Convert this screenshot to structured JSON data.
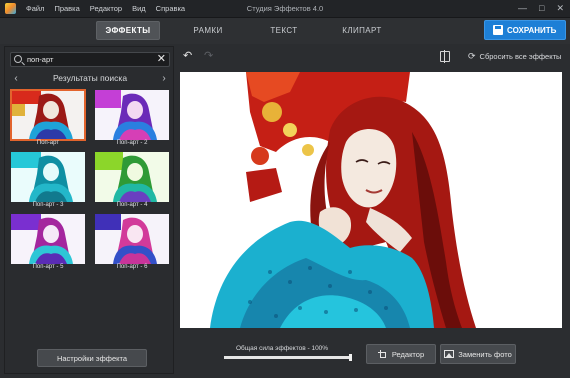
{
  "window": {
    "title": "Студия Эффектов 4.0",
    "menu": [
      "Файл",
      "Правка",
      "Редактор",
      "Вид",
      "Справка"
    ]
  },
  "tabs": [
    {
      "label": "ЭФФЕКТЫ",
      "active": true
    },
    {
      "label": "РАМКИ",
      "active": false
    },
    {
      "label": "ТЕКСТ",
      "active": false
    },
    {
      "label": "КЛИПАРТ",
      "active": false
    }
  ],
  "save_label": "СОХРАНИТЬ",
  "search": {
    "value": "поп-арт",
    "placeholder": ""
  },
  "results_title": "Результаты поиска",
  "effects": [
    {
      "label": "Поп-арт",
      "selected": true
    },
    {
      "label": "Поп-арт - 2",
      "selected": false
    },
    {
      "label": "Поп-арт - 3",
      "selected": false
    },
    {
      "label": "Поп-арт - 4",
      "selected": false
    },
    {
      "label": "Поп-арт - 5",
      "selected": false
    },
    {
      "label": "Поп-арт - 6",
      "selected": false
    }
  ],
  "settings_label": "Настройки эффекта",
  "reset_label": "Сбросить все эффекты",
  "strength": {
    "label": "Общая сила эффектов - 100%",
    "value": 100
  },
  "editor_label": "Редактор",
  "replace_label": "Заменить фото",
  "colors": {
    "accent": "#1d7fd6",
    "selection": "#e2642d",
    "background": "#2b2d30"
  }
}
